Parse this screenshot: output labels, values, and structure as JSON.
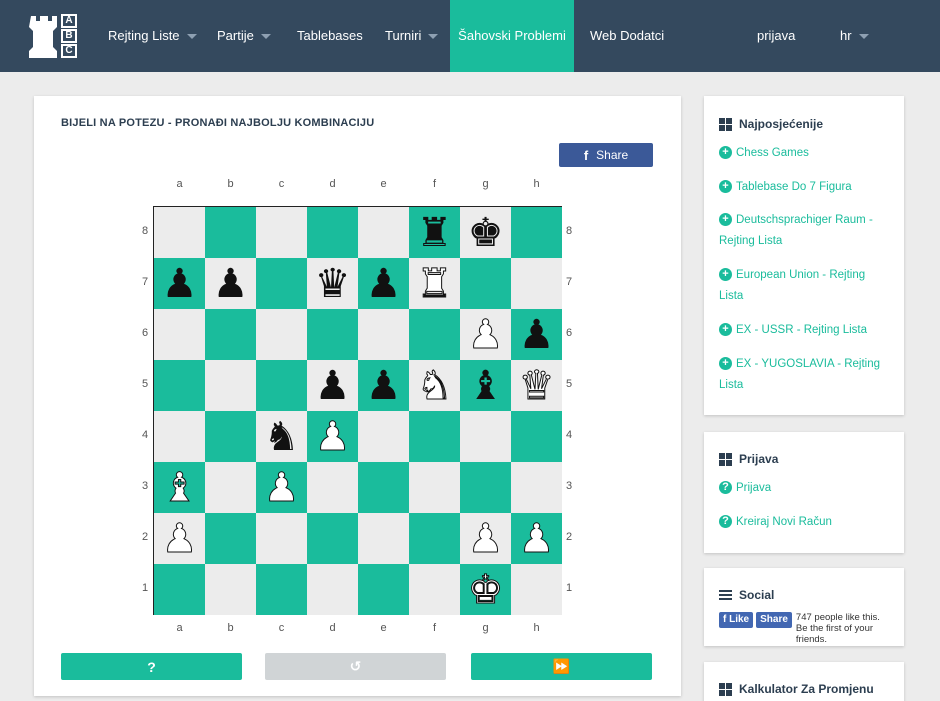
{
  "nav": {
    "logo_letters": [
      "A",
      "B",
      "C"
    ],
    "items": [
      {
        "label": "Rejting Liste",
        "dropdown": true
      },
      {
        "label": "Partije",
        "dropdown": true
      },
      {
        "label": "Tablebases",
        "dropdown": false
      },
      {
        "label": "Turniri",
        "dropdown": true
      },
      {
        "label": "Šahovski Problemi",
        "dropdown": false,
        "active": true
      },
      {
        "label": "Web Dodatci",
        "dropdown": false
      }
    ],
    "login": "prijava",
    "lang": "hr"
  },
  "puzzle": {
    "title": "BIJELI NA POTEZU - PRONAĐI NAJBOLJU KOMBINACIJU",
    "share_label": "Share",
    "files": [
      "a",
      "b",
      "c",
      "d",
      "e",
      "f",
      "g",
      "h"
    ],
    "ranks": [
      "8",
      "7",
      "6",
      "5",
      "4",
      "3",
      "2",
      "1"
    ],
    "board": [
      [
        "",
        "",
        "",
        "",
        "",
        "bR",
        "bK",
        ""
      ],
      [
        "bP",
        "bP",
        "",
        "bQ",
        "bP",
        "wR",
        "",
        ""
      ],
      [
        "",
        "",
        "",
        "",
        "",
        "",
        "wP",
        "bP"
      ],
      [
        "",
        "",
        "",
        "bP",
        "bP",
        "wN",
        "bB",
        "wQ"
      ],
      [
        "",
        "",
        "bN",
        "wP",
        "",
        "",
        "",
        ""
      ],
      [
        "wB",
        "",
        "wP",
        "",
        "",
        "",
        "",
        ""
      ],
      [
        "wP",
        "",
        "",
        "",
        "",
        "",
        "wP",
        "wP"
      ],
      [
        "",
        "",
        "",
        "",
        "",
        "",
        "wK",
        ""
      ]
    ],
    "buttons": {
      "hint": "?",
      "undo": "↺",
      "forward": "⏩"
    }
  },
  "sidebar": {
    "popular": {
      "title": "Najposjećenije",
      "links": [
        "Chess Games",
        "Tablebase Do 7 Figura",
        "Deutschsprachiger Raum - Rejting Lista",
        "European Union - Rejting Lista",
        "EX - USSR - Rejting Lista",
        "EX - YUGOSLAVIA - Rejting Lista"
      ]
    },
    "login": {
      "title": "Prijava",
      "links": [
        "Prijava",
        "Kreiraj Novi Račun"
      ]
    },
    "social": {
      "title": "Social",
      "like_label": "Like",
      "share_label": "Share",
      "text": "747 people like this. Be the first of your friends."
    },
    "calculator": {
      "title": "Kalkulator Za Promjenu"
    }
  },
  "colors": {
    "nav": "#34495e",
    "accent": "#1abc9c",
    "facebook": "#3b5998",
    "disabled": "#d0d4d6"
  }
}
